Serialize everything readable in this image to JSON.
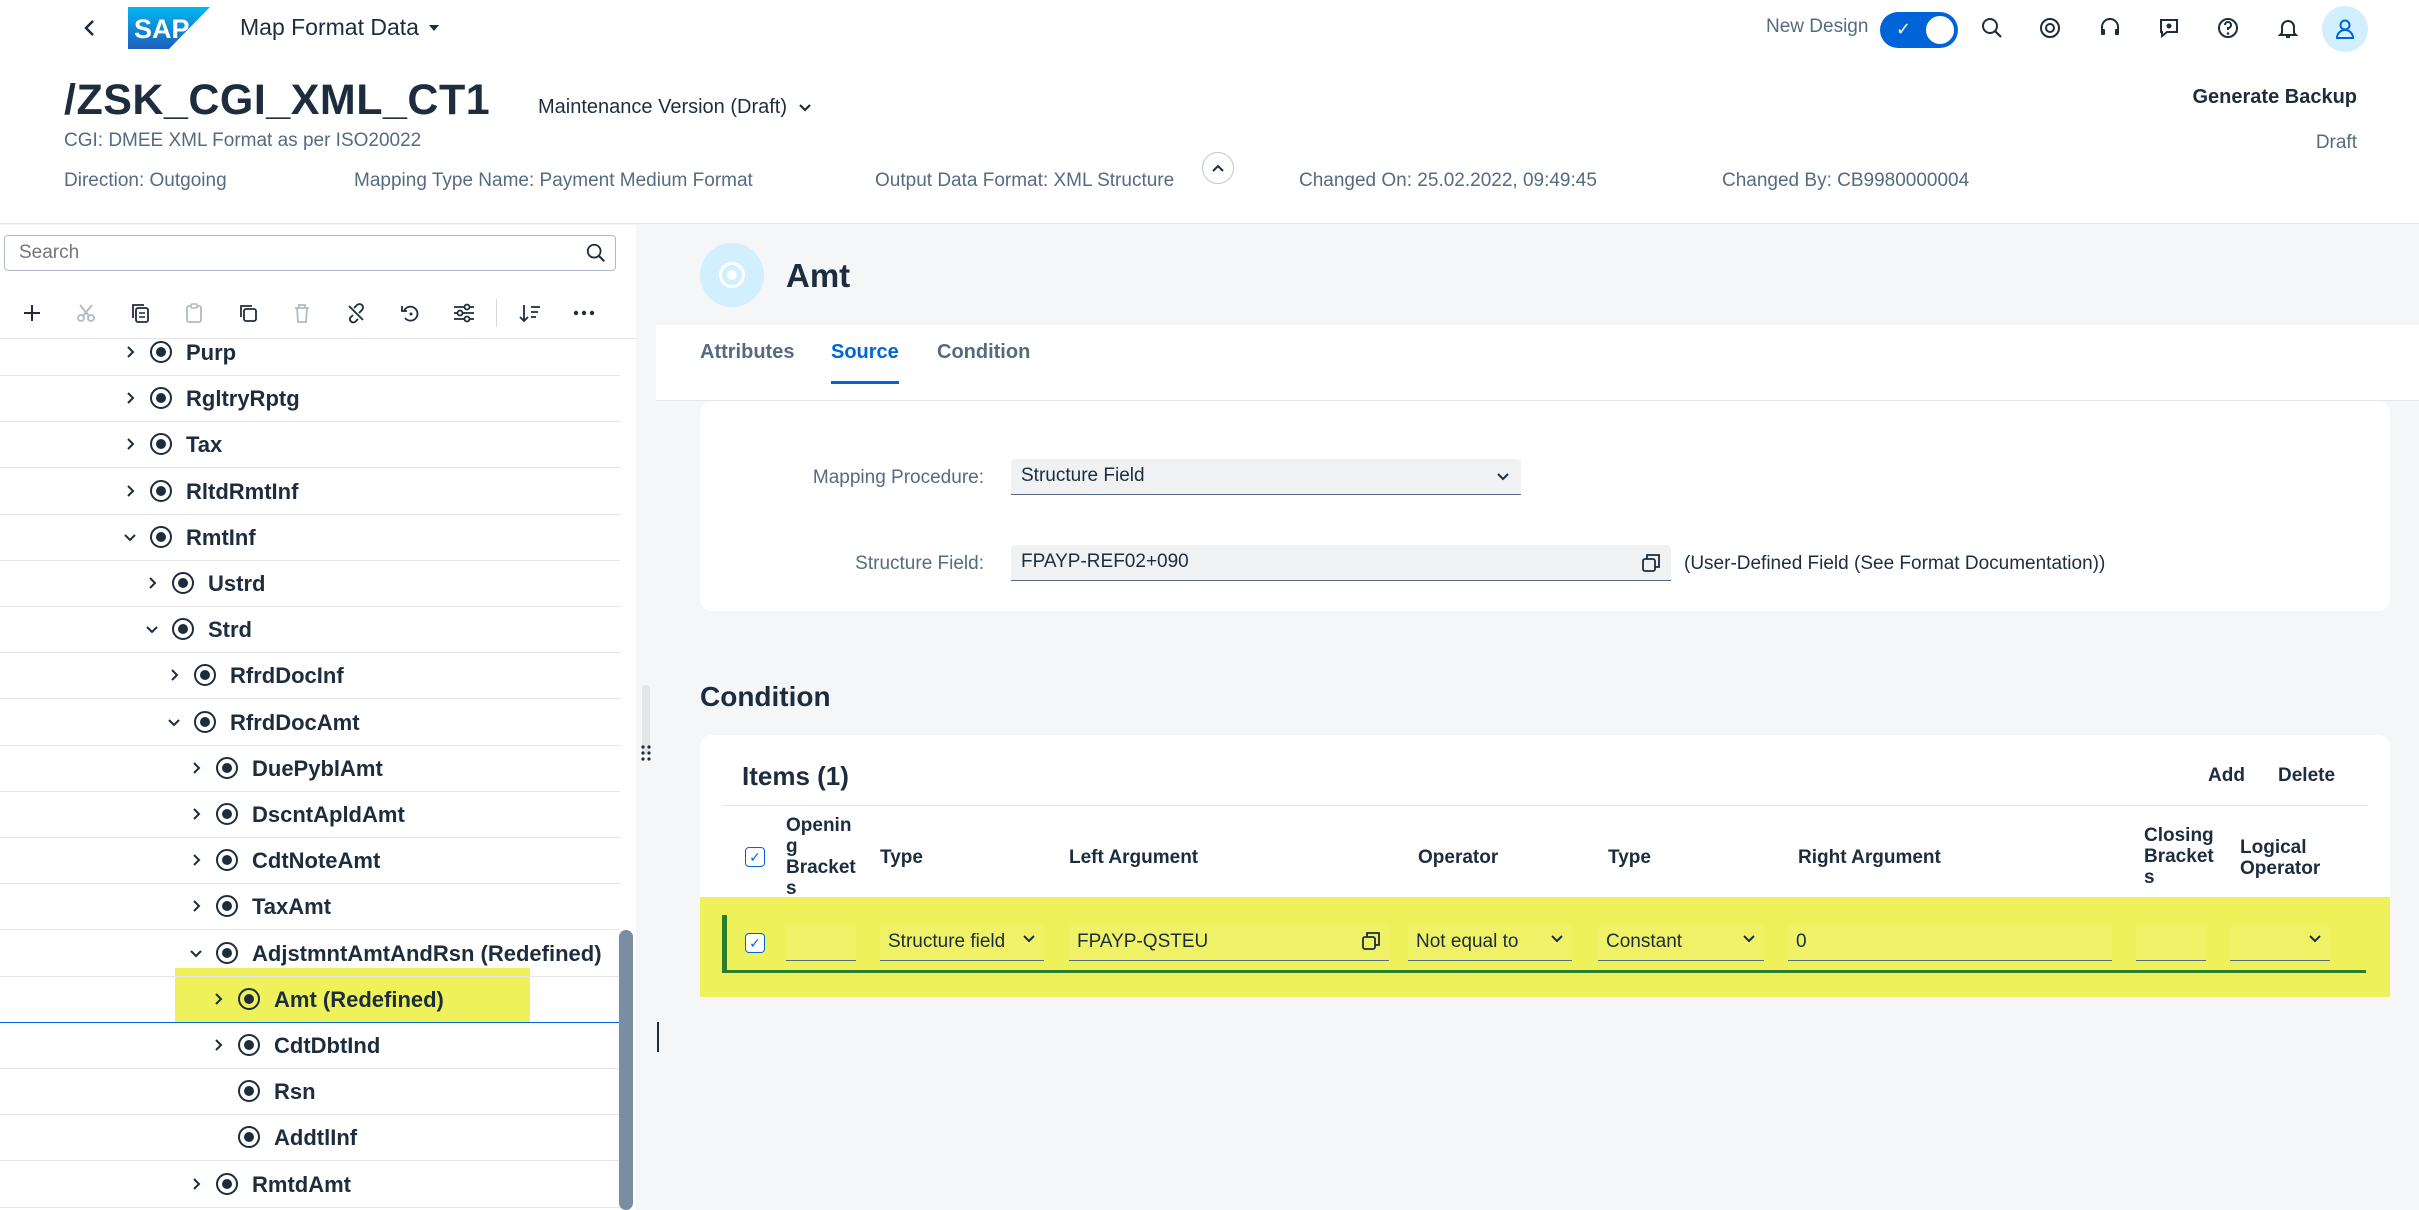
{
  "shell": {
    "logo_text": "SAP",
    "app_title": "Map Format Data",
    "new_design_label": "New Design",
    "icons": [
      "search-icon",
      "copilot-icon",
      "headset-icon",
      "feedback-icon",
      "help-icon",
      "notification-icon",
      "user-icon"
    ],
    "accent": "#0064d9"
  },
  "header": {
    "title": "/ZSK_CGI_XML_CT1",
    "version": "Maintenance Version (Draft)",
    "subtitle": "CGI: DMEE XML Format as per ISO20022",
    "generate_backup": "Generate Backup",
    "status": "Draft",
    "attributes": [
      "Direction: Outgoing",
      "Mapping Type Name: Payment Medium Format",
      "Output Data Format: XML Structure",
      "Changed On: 25.02.2022, 09:49:45",
      "Changed By: CB9980000004"
    ]
  },
  "left": {
    "search_placeholder": "Search",
    "toolbar_icons": [
      "add-icon",
      "cut-icon",
      "copy-icon",
      "paste-icon",
      "duplicate-icon",
      "delete-icon",
      "unlink-icon",
      "undo-icon",
      "settings-icon",
      "sort-icon",
      "more-icon"
    ],
    "tree": [
      {
        "label": "Purp",
        "level": 0,
        "expand": "collapsed"
      },
      {
        "label": "RgltryRptg",
        "level": 0,
        "expand": "collapsed"
      },
      {
        "label": "Tax",
        "level": 0,
        "expand": "collapsed"
      },
      {
        "label": "RltdRmtInf",
        "level": 0,
        "expand": "collapsed"
      },
      {
        "label": "RmtInf",
        "level": 0,
        "expand": "expanded"
      },
      {
        "label": "Ustrd",
        "level": 1,
        "expand": "collapsed"
      },
      {
        "label": "Strd",
        "level": 1,
        "expand": "expanded"
      },
      {
        "label": "RfrdDocInf",
        "level": 2,
        "expand": "collapsed"
      },
      {
        "label": "RfrdDocAmt",
        "level": 2,
        "expand": "expanded"
      },
      {
        "label": "DuePyblAmt",
        "level": 3,
        "expand": "collapsed"
      },
      {
        "label": "DscntApldAmt",
        "level": 3,
        "expand": "collapsed"
      },
      {
        "label": "CdtNoteAmt",
        "level": 3,
        "expand": "collapsed"
      },
      {
        "label": "TaxAmt",
        "level": 3,
        "expand": "collapsed"
      },
      {
        "label": "AdjstmntAmtAndRsn (Redefined)",
        "level": 3,
        "expand": "expanded"
      },
      {
        "label": "Amt (Redefined)",
        "level": 4,
        "expand": "collapsed",
        "selected": true
      },
      {
        "label": "CdtDbtInd",
        "level": 4,
        "expand": "collapsed"
      },
      {
        "label": "Rsn",
        "level": 4,
        "expand": "none"
      },
      {
        "label": "AddtlInf",
        "level": 4,
        "expand": "none"
      },
      {
        "label": "RmtdAmt",
        "level": 3,
        "expand": "collapsed"
      }
    ]
  },
  "detail": {
    "node_title": "Amt",
    "tabs": [
      "Attributes",
      "Source",
      "Condition"
    ],
    "active_tab": "Source",
    "mapping_procedure_label": "Mapping Procedure:",
    "mapping_procedure_value": "Structure Field",
    "structure_field_label": "Structure Field:",
    "structure_field_value": "FPAYP-REF02+090",
    "structure_field_desc": "(User-Defined Field (See Format Documentation))",
    "condition_title": "Condition",
    "items_title": "Items (1)",
    "add_label": "Add",
    "delete_label": "Delete",
    "columns": {
      "opening": "Openin\ng\nBracket\ns",
      "type": "Type",
      "left_arg": "Left Argument",
      "operator": "Operator",
      "type2": "Type",
      "right_arg": "Right Argument",
      "closing": "Closing\nBracket\ns",
      "logical": "Logical\nOperator"
    },
    "row": {
      "opening": "",
      "type": "Structure field",
      "left_arg": "FPAYP-QSTEU",
      "operator": "Not equal to",
      "type2": "Constant",
      "right_arg": "0",
      "closing": "",
      "logical": ""
    },
    "highlight_color": "#eef15a"
  }
}
